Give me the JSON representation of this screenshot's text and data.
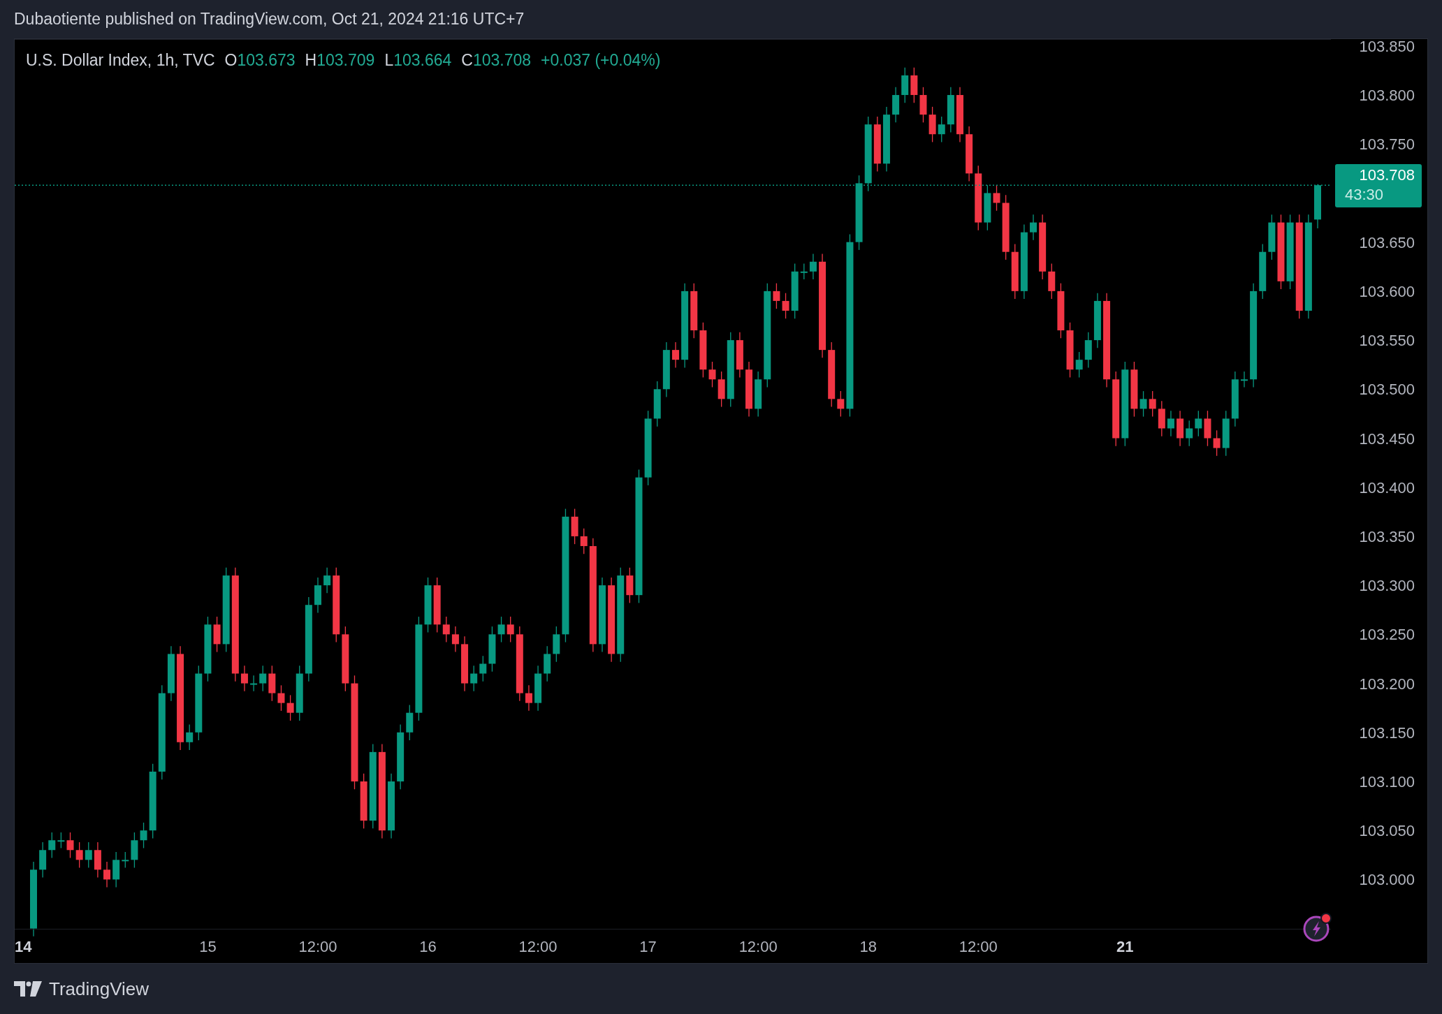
{
  "header": {
    "text": "Dubaotiente published on TradingView.com, Oct 21, 2024 21:16 UTC+7"
  },
  "legend": {
    "title": "U.S. Dollar Index, 1h, TVC",
    "fields": [
      {
        "label": "O",
        "value": "103.673"
      },
      {
        "label": "H",
        "value": "103.709"
      },
      {
        "label": "L",
        "value": "103.664"
      },
      {
        "label": "C",
        "value": "103.708"
      }
    ],
    "change": "+0.037 (+0.04%)"
  },
  "chart": {
    "chart_data": {
      "type": "candlestick",
      "categories": [
        null,
        null,
        null,
        null,
        null,
        null,
        null,
        null,
        null,
        null,
        null,
        null,
        null,
        null,
        null,
        null,
        null,
        null,
        null,
        null,
        null,
        null,
        null,
        null,
        null,
        null,
        null,
        null,
        null,
        null,
        null,
        null,
        null,
        null,
        null,
        null,
        null,
        null,
        null,
        null,
        null,
        null,
        null,
        null,
        null,
        null,
        null,
        null,
        null,
        null,
        null,
        null,
        null,
        null,
        null,
        null,
        null,
        null,
        null,
        null,
        null,
        null,
        null,
        null,
        null,
        null,
        null,
        null,
        null,
        null,
        null,
        null,
        null,
        null,
        null,
        null,
        null,
        null,
        null,
        null,
        null,
        null,
        null,
        null,
        null,
        null,
        null,
        null,
        null,
        null,
        null,
        null,
        null,
        null,
        null,
        null,
        null,
        null,
        null,
        null,
        null,
        null,
        null,
        null,
        null,
        null,
        null,
        null,
        null,
        null,
        null,
        null,
        null,
        null,
        null,
        null,
        null,
        null,
        null,
        null,
        null,
        null,
        null,
        null,
        null,
        null,
        null,
        null,
        null,
        null,
        null,
        null,
        null,
        null,
        null,
        null,
        null,
        null,
        null,
        null,
        null
      ],
      "ohlc": [
        [
          102.95,
          103.018,
          102.942,
          103.01
        ],
        [
          103.01,
          103.038,
          103.002,
          103.03
        ],
        [
          103.03,
          103.048,
          103.022,
          103.04
        ],
        [
          103.04,
          103.048,
          103.032,
          103.04
        ],
        [
          103.04,
          103.048,
          103.022,
          103.03
        ],
        [
          103.03,
          103.038,
          103.012,
          103.02
        ],
        [
          103.02,
          103.038,
          103.012,
          103.03
        ],
        [
          103.03,
          103.038,
          103.002,
          103.01
        ],
        [
          103.01,
          103.018,
          102.992,
          103.0
        ],
        [
          103.0,
          103.028,
          102.992,
          103.02
        ],
        [
          103.02,
          103.028,
          103.012,
          103.02
        ],
        [
          103.02,
          103.048,
          103.012,
          103.04
        ],
        [
          103.04,
          103.058,
          103.032,
          103.05
        ],
        [
          103.05,
          103.118,
          103.042,
          103.11
        ],
        [
          103.11,
          103.198,
          103.102,
          103.19
        ],
        [
          103.19,
          103.238,
          103.182,
          103.23
        ],
        [
          103.23,
          103.238,
          103.132,
          103.14
        ],
        [
          103.14,
          103.158,
          103.132,
          103.15
        ],
        [
          103.15,
          103.218,
          103.142,
          103.21
        ],
        [
          103.21,
          103.268,
          103.202,
          103.26
        ],
        [
          103.26,
          103.268,
          103.232,
          103.24
        ],
        [
          103.24,
          103.318,
          103.232,
          103.31
        ],
        [
          103.31,
          103.318,
          103.202,
          103.21
        ],
        [
          103.21,
          103.218,
          103.192,
          103.2
        ],
        [
          103.2,
          103.208,
          103.192,
          103.2
        ],
        [
          103.2,
          103.218,
          103.192,
          103.21
        ],
        [
          103.21,
          103.218,
          103.182,
          103.19
        ],
        [
          103.19,
          103.198,
          103.172,
          103.18
        ],
        [
          103.18,
          103.188,
          103.162,
          103.17
        ],
        [
          103.17,
          103.218,
          103.162,
          103.21
        ],
        [
          103.21,
          103.288,
          103.202,
          103.28
        ],
        [
          103.28,
          103.308,
          103.272,
          103.3
        ],
        [
          103.3,
          103.318,
          103.292,
          103.31
        ],
        [
          103.31,
          103.318,
          103.242,
          103.25
        ],
        [
          103.25,
          103.258,
          103.192,
          103.2
        ],
        [
          103.2,
          103.208,
          103.092,
          103.1
        ],
        [
          103.1,
          103.108,
          103.052,
          103.06
        ],
        [
          103.06,
          103.138,
          103.052,
          103.13
        ],
        [
          103.13,
          103.138,
          103.042,
          103.05
        ],
        [
          103.05,
          103.108,
          103.042,
          103.1
        ],
        [
          103.1,
          103.158,
          103.092,
          103.15
        ],
        [
          103.15,
          103.178,
          103.142,
          103.17
        ],
        [
          103.17,
          103.268,
          103.162,
          103.26
        ],
        [
          103.26,
          103.308,
          103.252,
          103.3
        ],
        [
          103.3,
          103.308,
          103.252,
          103.26
        ],
        [
          103.26,
          103.268,
          103.242,
          103.25
        ],
        [
          103.25,
          103.258,
          103.232,
          103.24
        ],
        [
          103.24,
          103.248,
          103.192,
          103.2
        ],
        [
          103.2,
          103.218,
          103.192,
          103.21
        ],
        [
          103.21,
          103.228,
          103.202,
          103.22
        ],
        [
          103.22,
          103.258,
          103.212,
          103.25
        ],
        [
          103.25,
          103.268,
          103.242,
          103.26
        ],
        [
          103.26,
          103.268,
          103.242,
          103.25
        ],
        [
          103.25,
          103.258,
          103.182,
          103.19
        ],
        [
          103.19,
          103.198,
          103.172,
          103.18
        ],
        [
          103.18,
          103.218,
          103.172,
          103.21
        ],
        [
          103.21,
          103.238,
          103.202,
          103.23
        ],
        [
          103.23,
          103.258,
          103.222,
          103.25
        ],
        [
          103.25,
          103.378,
          103.242,
          103.37
        ],
        [
          103.37,
          103.378,
          103.342,
          103.35
        ],
        [
          103.35,
          103.358,
          103.332,
          103.34
        ],
        [
          103.34,
          103.348,
          103.232,
          103.24
        ],
        [
          103.24,
          103.308,
          103.232,
          103.3
        ],
        [
          103.3,
          103.308,
          103.222,
          103.23
        ],
        [
          103.23,
          103.318,
          103.222,
          103.31
        ],
        [
          103.31,
          103.318,
          103.282,
          103.29
        ],
        [
          103.29,
          103.418,
          103.282,
          103.41
        ],
        [
          103.41,
          103.478,
          103.402,
          103.47
        ],
        [
          103.47,
          103.508,
          103.462,
          103.5
        ],
        [
          103.5,
          103.548,
          103.492,
          103.54
        ],
        [
          103.54,
          103.548,
          103.522,
          103.53
        ],
        [
          103.53,
          103.608,
          103.522,
          103.6
        ],
        [
          103.6,
          103.608,
          103.552,
          103.56
        ],
        [
          103.56,
          103.568,
          103.512,
          103.52
        ],
        [
          103.52,
          103.528,
          103.502,
          103.51
        ],
        [
          103.51,
          103.518,
          103.482,
          103.49
        ],
        [
          103.49,
          103.558,
          103.482,
          103.55
        ],
        [
          103.55,
          103.558,
          103.512,
          103.52
        ],
        [
          103.52,
          103.528,
          103.472,
          103.48
        ],
        [
          103.48,
          103.518,
          103.472,
          103.51
        ],
        [
          103.51,
          103.608,
          103.502,
          103.6
        ],
        [
          103.6,
          103.608,
          103.582,
          103.59
        ],
        [
          103.59,
          103.598,
          103.572,
          103.58
        ],
        [
          103.58,
          103.628,
          103.572,
          103.62
        ],
        [
          103.62,
          103.628,
          103.612,
          103.62
        ],
        [
          103.62,
          103.638,
          103.612,
          103.63
        ],
        [
          103.63,
          103.638,
          103.532,
          103.54
        ],
        [
          103.54,
          103.548,
          103.482,
          103.49
        ],
        [
          103.49,
          103.498,
          103.472,
          103.48
        ],
        [
          103.48,
          103.658,
          103.472,
          103.65
        ],
        [
          103.65,
          103.718,
          103.642,
          103.71
        ],
        [
          103.71,
          103.778,
          103.702,
          103.77
        ],
        [
          103.77,
          103.778,
          103.722,
          103.73
        ],
        [
          103.73,
          103.788,
          103.722,
          103.78
        ],
        [
          103.78,
          103.808,
          103.772,
          103.8
        ],
        [
          103.8,
          103.828,
          103.792,
          103.82
        ],
        [
          103.82,
          103.828,
          103.792,
          103.8
        ],
        [
          103.8,
          103.808,
          103.772,
          103.78
        ],
        [
          103.78,
          103.788,
          103.752,
          103.76
        ],
        [
          103.76,
          103.778,
          103.752,
          103.77
        ],
        [
          103.77,
          103.808,
          103.762,
          103.8
        ],
        [
          103.8,
          103.808,
          103.752,
          103.76
        ],
        [
          103.76,
          103.768,
          103.712,
          103.72
        ],
        [
          103.72,
          103.728,
          103.662,
          103.67
        ],
        [
          103.67,
          103.708,
          103.662,
          103.7
        ],
        [
          103.7,
          103.708,
          103.682,
          103.69
        ],
        [
          103.69,
          103.698,
          103.632,
          103.64
        ],
        [
          103.64,
          103.648,
          103.592,
          103.6
        ],
        [
          103.6,
          103.668,
          103.592,
          103.66
        ],
        [
          103.66,
          103.678,
          103.652,
          103.67
        ],
        [
          103.67,
          103.678,
          103.612,
          103.62
        ],
        [
          103.62,
          103.628,
          103.592,
          103.6
        ],
        [
          103.6,
          103.608,
          103.552,
          103.56
        ],
        [
          103.56,
          103.568,
          103.512,
          103.52
        ],
        [
          103.52,
          103.538,
          103.512,
          103.53
        ],
        [
          103.53,
          103.558,
          103.522,
          103.55
        ],
        [
          103.55,
          103.598,
          103.542,
          103.59
        ],
        [
          103.59,
          103.598,
          103.502,
          103.51
        ],
        [
          103.51,
          103.518,
          103.442,
          103.45
        ],
        [
          103.45,
          103.528,
          103.442,
          103.52
        ],
        [
          103.52,
          103.528,
          103.472,
          103.48
        ],
        [
          103.48,
          103.498,
          103.472,
          103.49
        ],
        [
          103.49,
          103.498,
          103.472,
          103.48
        ],
        [
          103.48,
          103.488,
          103.452,
          103.46
        ],
        [
          103.46,
          103.478,
          103.452,
          103.47
        ],
        [
          103.47,
          103.478,
          103.442,
          103.45
        ],
        [
          103.45,
          103.468,
          103.442,
          103.46
        ],
        [
          103.46,
          103.478,
          103.452,
          103.47
        ],
        [
          103.47,
          103.478,
          103.442,
          103.45
        ],
        [
          103.45,
          103.458,
          103.432,
          103.44
        ],
        [
          103.44,
          103.478,
          103.432,
          103.47
        ],
        [
          103.47,
          103.518,
          103.462,
          103.51
        ],
        [
          103.51,
          103.518,
          103.502,
          103.51
        ],
        [
          103.51,
          103.608,
          103.502,
          103.6
        ],
        [
          103.6,
          103.648,
          103.592,
          103.64
        ],
        [
          103.64,
          103.678,
          103.632,
          103.67
        ],
        [
          103.67,
          103.678,
          103.602,
          103.61
        ],
        [
          103.61,
          103.678,
          103.602,
          103.67
        ],
        [
          103.67,
          103.678,
          103.572,
          103.58
        ],
        [
          103.58,
          103.678,
          103.572,
          103.67
        ],
        [
          103.673,
          103.709,
          103.664,
          103.708
        ]
      ],
      "ylim": [
        102.949,
        103.857
      ],
      "ref_lines": [
        {
          "axis": "y",
          "value": 103.708
        }
      ],
      "yticks": [
        {
          "value": 103.85,
          "label": "103.850"
        },
        {
          "value": 103.8,
          "label": "103.800"
        },
        {
          "value": 103.75,
          "label": "103.750"
        },
        {
          "value": 103.65,
          "label": "103.650"
        },
        {
          "value": 103.6,
          "label": "103.600"
        },
        {
          "value": 103.55,
          "label": "103.550"
        },
        {
          "value": 103.5,
          "label": "103.500"
        },
        {
          "value": 103.45,
          "label": "103.450"
        },
        {
          "value": 103.4,
          "label": "103.400"
        },
        {
          "value": 103.35,
          "label": "103.350"
        },
        {
          "value": 103.3,
          "label": "103.300"
        },
        {
          "value": 103.25,
          "label": "103.250"
        },
        {
          "value": 103.2,
          "label": "103.200"
        },
        {
          "value": 103.15,
          "label": "103.150"
        },
        {
          "value": 103.1,
          "label": "103.100"
        },
        {
          "value": 103.05,
          "label": "103.050"
        },
        {
          "value": 103.0,
          "label": "103.000"
        }
      ]
    }
  },
  "time_axis": {
    "labels": [
      {
        "text": "14",
        "emphasized": true
      },
      {
        "text": "15",
        "emphasized": false
      },
      {
        "text": "12:00",
        "emphasized": false
      },
      {
        "text": "16",
        "emphasized": false
      },
      {
        "text": "12:00",
        "emphasized": false
      },
      {
        "text": "17",
        "emphasized": false
      },
      {
        "text": "12:00",
        "emphasized": false
      },
      {
        "text": "18",
        "emphasized": false
      },
      {
        "text": "12:00",
        "emphasized": false
      },
      {
        "text": "21",
        "emphasized": true
      }
    ]
  },
  "last_price": {
    "price": "103.708",
    "countdown": "43:30"
  },
  "footer": {
    "brand": "TradingView"
  }
}
